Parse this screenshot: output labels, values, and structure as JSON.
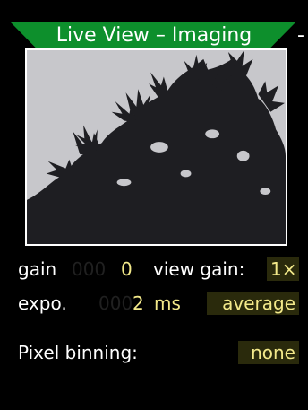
{
  "header": {
    "title": "Live View – Imaging",
    "trailing": "-"
  },
  "preview": {
    "subject": "pine tree against grey sky",
    "colors": {
      "sky": "#c7c7cb",
      "foliage": "#1e1e22"
    }
  },
  "settings": {
    "gain": {
      "label": "gain",
      "ghost": "000",
      "value": "0"
    },
    "view_gain": {
      "label": "view gain:",
      "value": "1×"
    },
    "exposure": {
      "label": "expo.",
      "ghost": "000",
      "value": "2",
      "unit": "ms"
    },
    "mode": {
      "value": "average"
    },
    "pixel_binning": {
      "label": "Pixel binning:",
      "value": "none"
    }
  },
  "colors": {
    "title_bar": "#0d8f2c",
    "value_text": "#f3e98a",
    "highlight_bg": "#2a2a0c"
  }
}
